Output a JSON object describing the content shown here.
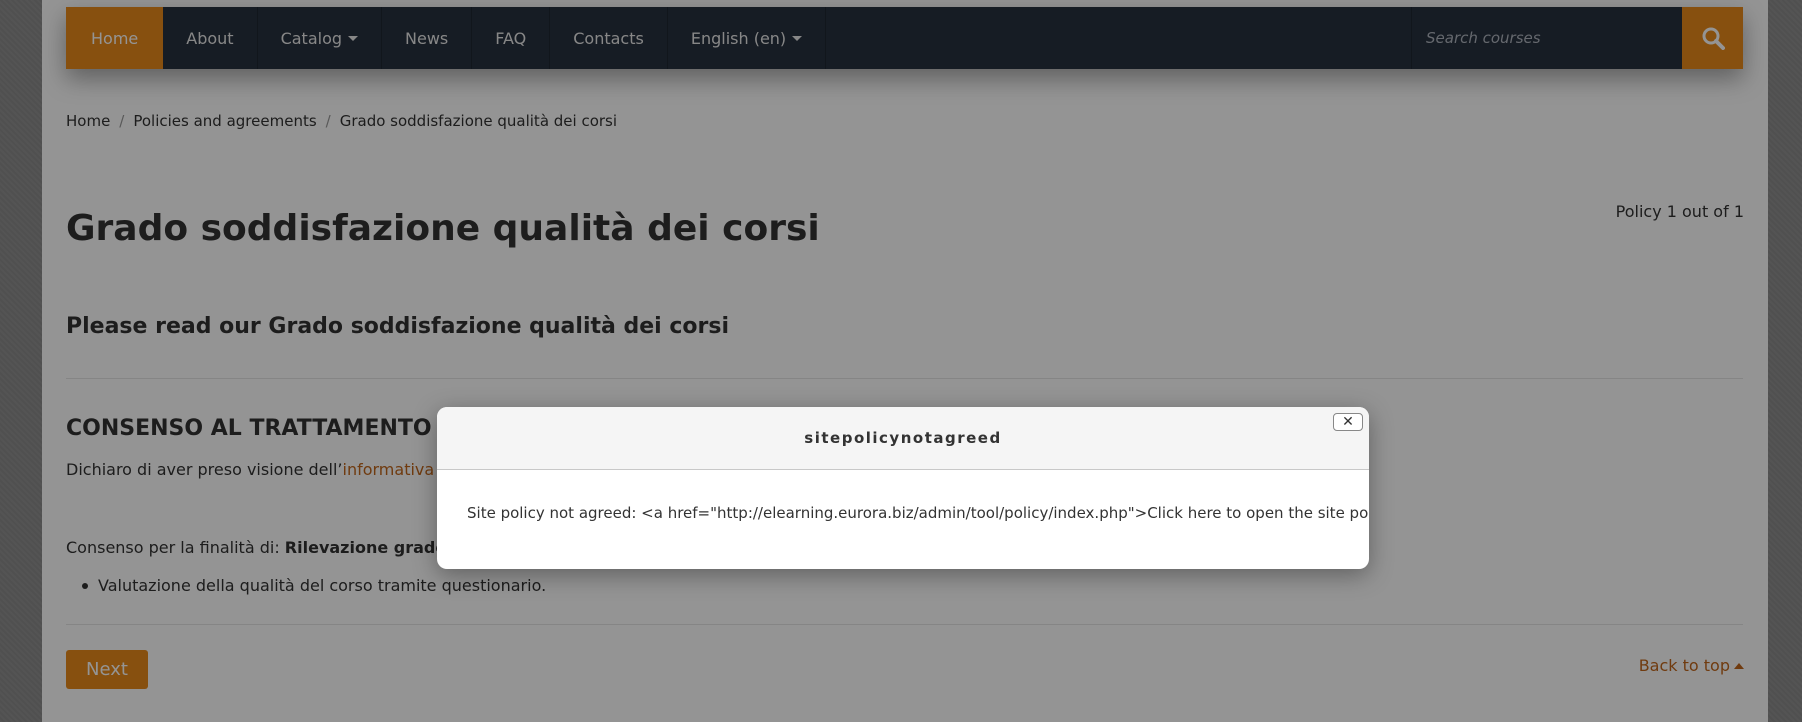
{
  "navbar": {
    "items": [
      {
        "label": "Home"
      },
      {
        "label": "About"
      },
      {
        "label": "Catalog"
      },
      {
        "label": "News"
      },
      {
        "label": "FAQ"
      },
      {
        "label": "Contacts"
      },
      {
        "label": "English (en)"
      }
    ],
    "search_placeholder": "Search courses"
  },
  "breadcrumb": {
    "items": [
      "Home",
      "Policies and agreements",
      "Grado soddisfazione qualità dei corsi"
    ],
    "separator": "/"
  },
  "page": {
    "policy_count": "Policy 1 out of 1",
    "title": "Grado soddisfazione qualità dei corsi",
    "subtitle": "Please read our Grado soddisfazione qualità dei corsi",
    "section_heading": "CONSENSO AL TRATTAMENTO DEI",
    "declare_text": "Dichiaro di aver preso visione dell’",
    "declare_link": "informativa rela",
    "consent_label": "Consenso per la finalità di: ",
    "consent_bold": "Rilevazione grado di s",
    "bullet_item": "Valutazione della qualità del corso tramite questionario.",
    "next_button": "Next",
    "back_to_top": "Back to top"
  },
  "modal": {
    "title": "sitepolicynotagreed",
    "close_glyph": "✕",
    "body": "Site policy not agreed: <a href=\"http://elearning.eurora.biz/admin/tool/policy/index.php\">Click here to open the site policy.</a>"
  },
  "colors": {
    "accent": "#e88a1a",
    "navbar_bg": "#27313f",
    "link": "#c1661b"
  }
}
